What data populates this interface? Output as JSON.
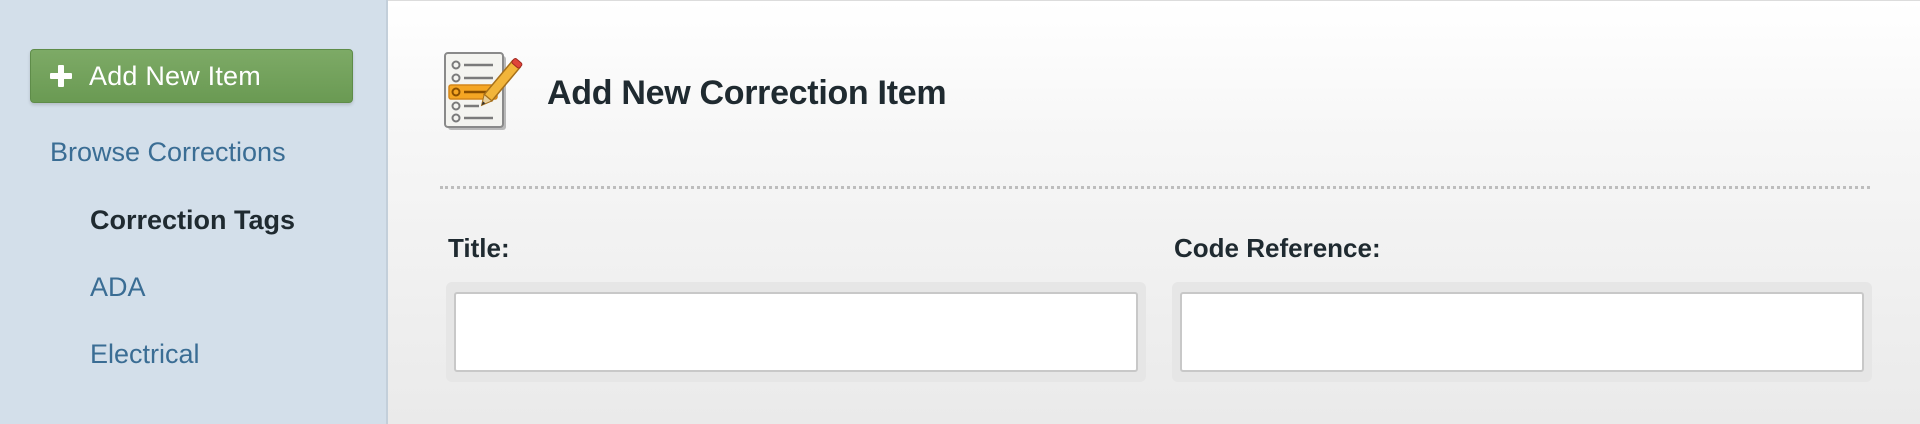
{
  "sidebar": {
    "add_button_label": "Add New Item",
    "browse_label": "Browse Corrections",
    "tags_label": "Correction Tags",
    "items": [
      {
        "label": "ADA"
      },
      {
        "label": "Electrical"
      }
    ]
  },
  "main": {
    "title": "Add New Correction Item",
    "icon": "notepad-pencil-icon",
    "fields": {
      "title_label": "Title:",
      "title_value": "",
      "code_label": "Code Reference:",
      "code_value": ""
    }
  },
  "colors": {
    "sidebar_bg": "#d3dfea",
    "add_button": "#6f9f58",
    "link": "#3a6d94",
    "text_dark": "#1f2a30"
  }
}
